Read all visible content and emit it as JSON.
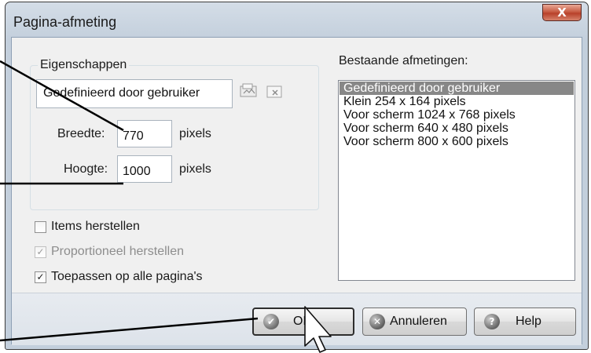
{
  "window": {
    "title": "Pagina-afmeting",
    "close_glyph": "X"
  },
  "properties": {
    "group_label": "Eigenschappen",
    "preset_value": "Gedefinieerd door gebruiker",
    "width_label": "Breedte:",
    "width_value": "770",
    "width_unit": "pixels",
    "height_label": "Hoogte:",
    "height_value": "1000",
    "height_unit": "pixels",
    "icons": [
      "save-preset-icon",
      "delete-preset-icon"
    ]
  },
  "options": [
    {
      "label": "Items herstellen",
      "checked": false,
      "enabled": true
    },
    {
      "label": "Proportioneel herstellen",
      "checked": true,
      "enabled": false
    },
    {
      "label": "Toepassen op alle pagina's",
      "checked": true,
      "enabled": true
    }
  ],
  "existing_sizes": {
    "label": "Bestaande afmetingen:",
    "items": [
      "Gedefinieerd door gebruiker",
      "Klein 254 x 164 pixels",
      "Voor scherm 1024 x 768 pixels",
      "Voor scherm 640 x 480 pixels",
      "Voor scherm 800 x 600 pixels"
    ],
    "selected_index": 0
  },
  "buttons": {
    "ok": "OK",
    "cancel": "Annuleren",
    "help": "Help"
  },
  "icons": {
    "ok": "check-icon",
    "cancel": "cancel-icon",
    "help": "help-icon",
    "pointer": "mouse-cursor-icon"
  }
}
